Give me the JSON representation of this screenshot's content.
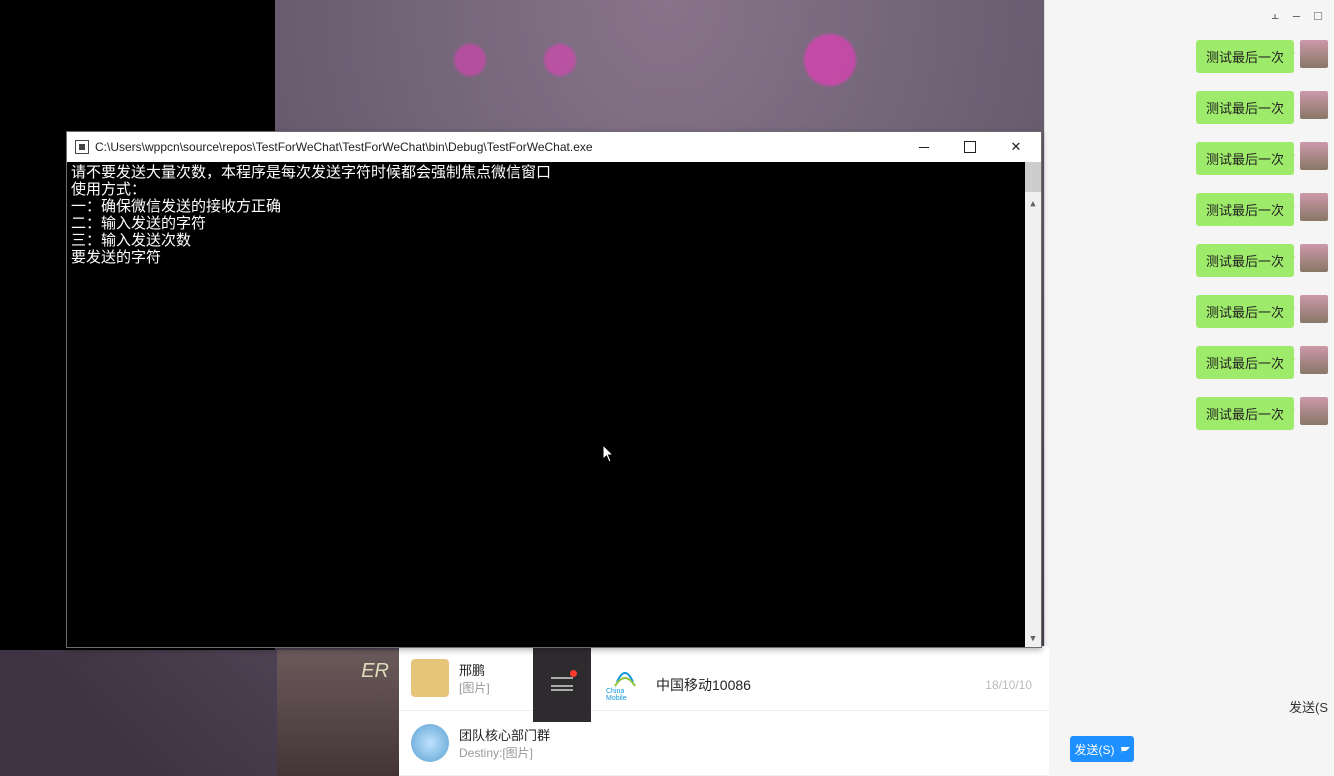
{
  "console": {
    "title": "C:\\Users\\wppcn\\source\\repos\\TestForWeChat\\TestForWeChat\\bin\\Debug\\TestForWeChat.exe",
    "lines": {
      "l0": "请不要发送大量次数，本程序是每次发送字符时候都会强制焦点微信窗口",
      "l1": "使用方式：",
      "l2": "一：确保微信发送的接收方正确",
      "l3": "二：输入发送的字符",
      "l4": "三：输入发送次数",
      "l5": "要发送的字符"
    }
  },
  "wechat": {
    "send_label": "发送(S)",
    "send_hint": "发送(S",
    "messages": [
      "测试最后一次",
      "测试最后一次",
      "测试最后一次",
      "测试最后一次",
      "测试最后一次",
      "测试最后一次",
      "测试最后一次",
      "测试最后一次"
    ]
  },
  "contacts": {
    "row1": {
      "name": "邢鹏",
      "sub": "[图片]"
    },
    "row2": {
      "name": "团队核心部门群",
      "sub": "Destiny:[图片]"
    },
    "mobile": {
      "name": "中国移动10086",
      "date": "18/10/10",
      "logo_label": "China Mobile"
    }
  },
  "titlebar_icons": {
    "pin": "⫠",
    "min": "–",
    "max": "□",
    "close": "✕"
  },
  "bg_badge": "ER"
}
